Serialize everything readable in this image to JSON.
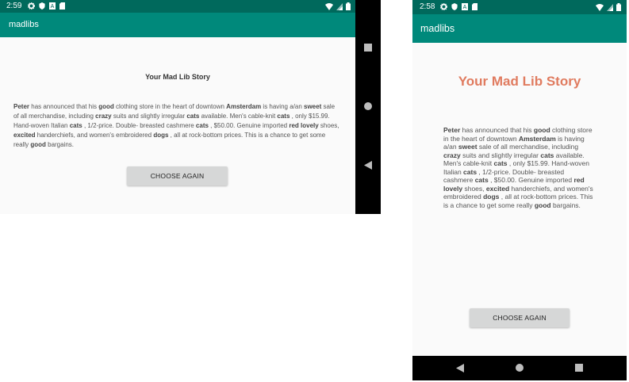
{
  "landscape": {
    "status_time": "2:59",
    "app_title": "madlibs",
    "story_title": "Your Mad Lib Story",
    "button_label": "CHOOSE AGAIN"
  },
  "portrait": {
    "status_time": "2:58",
    "app_title": "madlibs",
    "story_title": "Your Mad Lib Story",
    "button_label": "CHOOSE AGAIN"
  },
  "story": {
    "w1": "Peter",
    "t1": " has announced that his ",
    "w2": "good",
    "t2": " clothing store in the heart of downtown ",
    "w3": "Amsterdam",
    "t3": " is having a/an ",
    "w4": "sweet",
    "t4": " sale of all merchandise, including ",
    "w5": "crazy",
    "t5": " suits and slightly irregular ",
    "w6": "cats",
    "t6": " available. Men's cable-knit ",
    "w7": "cats",
    "t7": " , only $15.99. Hand-woven Italian ",
    "w8": "cats",
    "t8": " , 1/2-price. Double- breasted cashmere ",
    "w9": "cats",
    "t9": " , $50.00. Genuine imported ",
    "w10": "red lovely",
    "t10": " shoes, ",
    "w11": "excited",
    "t11": " handerchiefs, and women's embroidered ",
    "w12": "dogs",
    "t12": " , all at rock-bottom prices. This is a chance to get some really ",
    "w13": "good",
    "t13": " bargains."
  },
  "colors": {
    "status_bar": "#00695c",
    "app_bar": "#00897b",
    "title_landscape": "#333333",
    "title_portrait": "#e07b5f"
  },
  "icons": {
    "status_left": [
      "gear-icon",
      "shield-icon",
      "notification-icon",
      "sd-card-icon"
    ],
    "status_right": [
      "wifi-icon",
      "cellular-icon",
      "battery-icon"
    ],
    "nav": [
      "back-icon",
      "home-icon",
      "recents-icon"
    ]
  }
}
